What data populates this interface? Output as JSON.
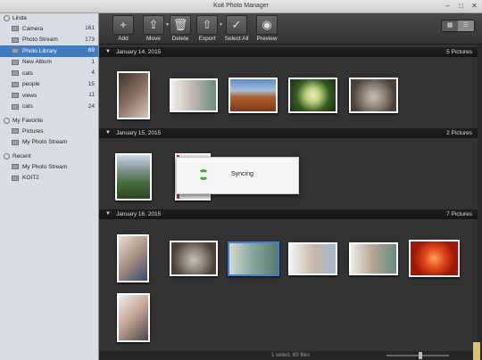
{
  "window": {
    "title": "Koit Photo Manager"
  },
  "sidebar": {
    "user": "Linda",
    "items": [
      {
        "label": "Camera",
        "count": "161"
      },
      {
        "label": "Photo Stream",
        "count": "173"
      },
      {
        "label": "Photo Library",
        "count": "69",
        "selected": true
      },
      {
        "label": "New Album",
        "count": "1"
      },
      {
        "label": "cats",
        "count": "4"
      },
      {
        "label": "people",
        "count": "15"
      },
      {
        "label": "views",
        "count": "11"
      },
      {
        "label": "cats",
        "count": "24"
      }
    ],
    "favorite_head": "My Favorite",
    "favorites": [
      {
        "label": "Pictures"
      },
      {
        "label": "My Photo Stream"
      }
    ],
    "recent_head": "Recent",
    "recents": [
      {
        "label": "My Photo Stream"
      },
      {
        "label": "KOIT2"
      }
    ]
  },
  "toolbar": {
    "add": "Add",
    "move": "Move",
    "delete": "Delete",
    "export": "Export",
    "select_all": "Select All",
    "preview": "Preview"
  },
  "sections": [
    {
      "date": "January 14, 2015",
      "count": "5 Pictures"
    },
    {
      "date": "January 15, 2015",
      "count": "2 Pictures"
    },
    {
      "date": "January 16, 2015",
      "count": "7 Pictures"
    }
  ],
  "dialog": {
    "message": "Syncing"
  },
  "status": {
    "text": "1 select, 69 files"
  },
  "colors": {
    "accent": "#3e7cc4",
    "sync": "#3cb043"
  }
}
